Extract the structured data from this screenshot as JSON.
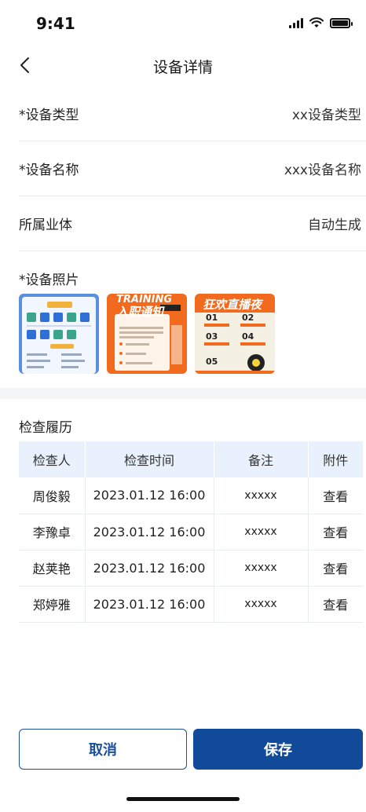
{
  "status": {
    "time": "9:41"
  },
  "nav": {
    "title": "设备详情",
    "back_icon": "chevron-left-icon"
  },
  "fields": [
    {
      "label": "*设备类型",
      "value": "xx设备类型"
    },
    {
      "label": "*设备名称",
      "value": "xxx设备名称"
    },
    {
      "label": "所属业体",
      "value": "自动生成"
    }
  ],
  "photos": {
    "label": "*设备照片",
    "thumb2": {
      "line1": "TRAINING",
      "line2": "入职通知"
    },
    "thumb3": {
      "title": "狂欢直播夜",
      "items": [
        "01",
        "02",
        "03",
        "04",
        "05"
      ]
    }
  },
  "history": {
    "title": "检查履历",
    "headers": [
      "检查人",
      "检查时间",
      "备注",
      "附件"
    ],
    "rows": [
      {
        "inspector": "周俊毅",
        "time": "2023.01.12 16:00",
        "note": "xxxxx",
        "attachment": "查看"
      },
      {
        "inspector": "李豫卓",
        "time": "2023.01.12 16:00",
        "note": "xxxxx",
        "attachment": "查看"
      },
      {
        "inspector": "赵荚艳",
        "time": "2023.01.12 16:00",
        "note": "xxxxx",
        "attachment": "查看"
      },
      {
        "inspector": "郑婷雅",
        "time": "2023.01.12 16:00",
        "note": "xxxxx",
        "attachment": "查看"
      }
    ]
  },
  "actions": {
    "cancel": "取消",
    "save": "保存"
  },
  "colors": {
    "primary": "#124a9a",
    "link": "#1858c8",
    "table_header": "#e8f1fc"
  }
}
